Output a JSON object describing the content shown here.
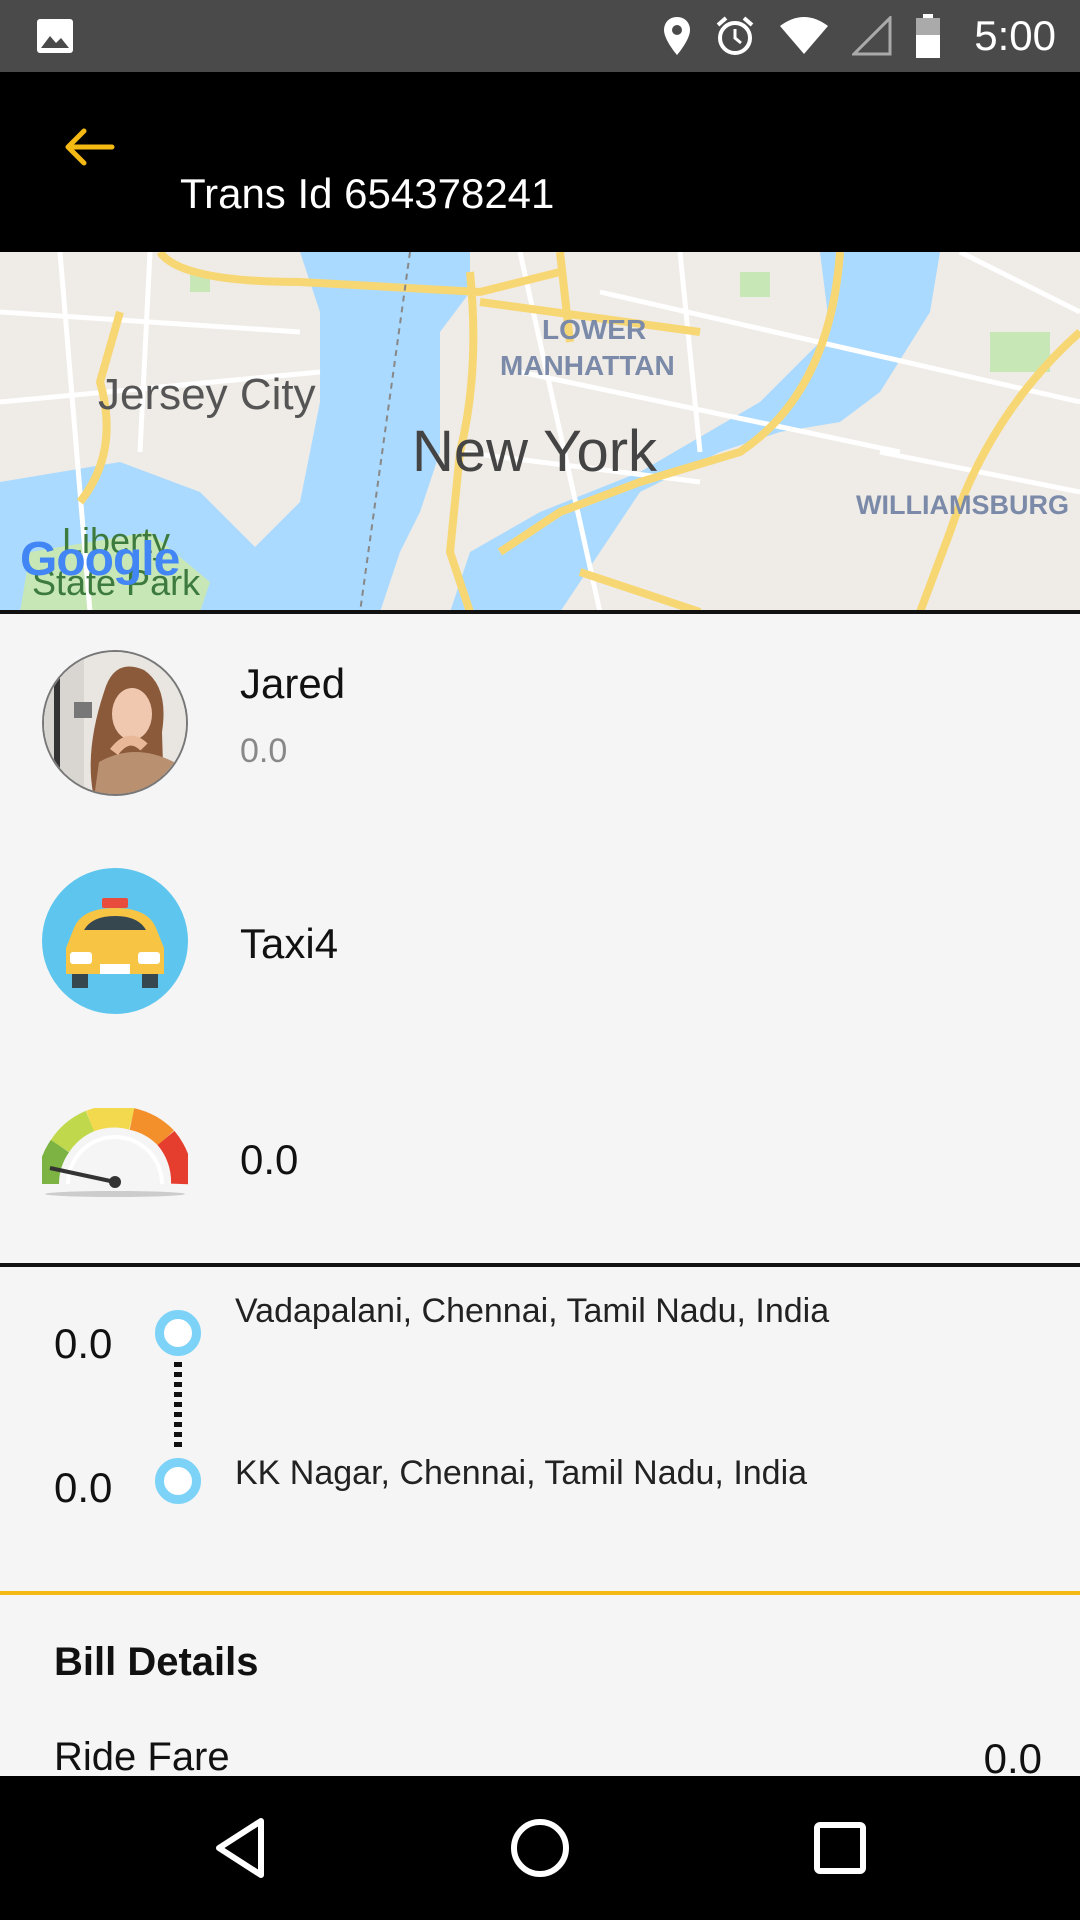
{
  "status_bar": {
    "time": "5:00",
    "icons": [
      "gallery-icon",
      "location-icon",
      "alarm-icon",
      "wifi-icon",
      "signal-icon",
      "battery-icon"
    ]
  },
  "toolbar": {
    "back_icon": "arrow-left-icon",
    "title": "Trans Id 654378241"
  },
  "map": {
    "labels": {
      "jersey_city": "Jersey City",
      "new_york": "New York",
      "lower_manhattan_1": "LOWER",
      "lower_manhattan_2": "MANHATTAN",
      "williamsburg": "WILLIAMSBURG",
      "liberty_1": "Liberty",
      "liberty_2": "State Park",
      "google": "Google"
    }
  },
  "driver": {
    "name": "Jared",
    "rating": "0.0"
  },
  "vehicle": {
    "name": "Taxi4"
  },
  "speed": {
    "value": "0.0"
  },
  "route": {
    "pickup_value": "0.0",
    "pickup_address": "Vadapalani, Chennai, Tamil Nadu, India",
    "drop_value": "0.0",
    "drop_address": "KK Nagar, Chennai, Tamil Nadu, India"
  },
  "bill": {
    "title": "Bill Details",
    "ride_fare_label": "Ride Fare",
    "ride_fare_value": "0.0"
  },
  "colors": {
    "accent": "#f5b914",
    "toolbar": "#000000",
    "statusbar": "#4a4a4a",
    "route_dot": "#7dd3f7"
  }
}
